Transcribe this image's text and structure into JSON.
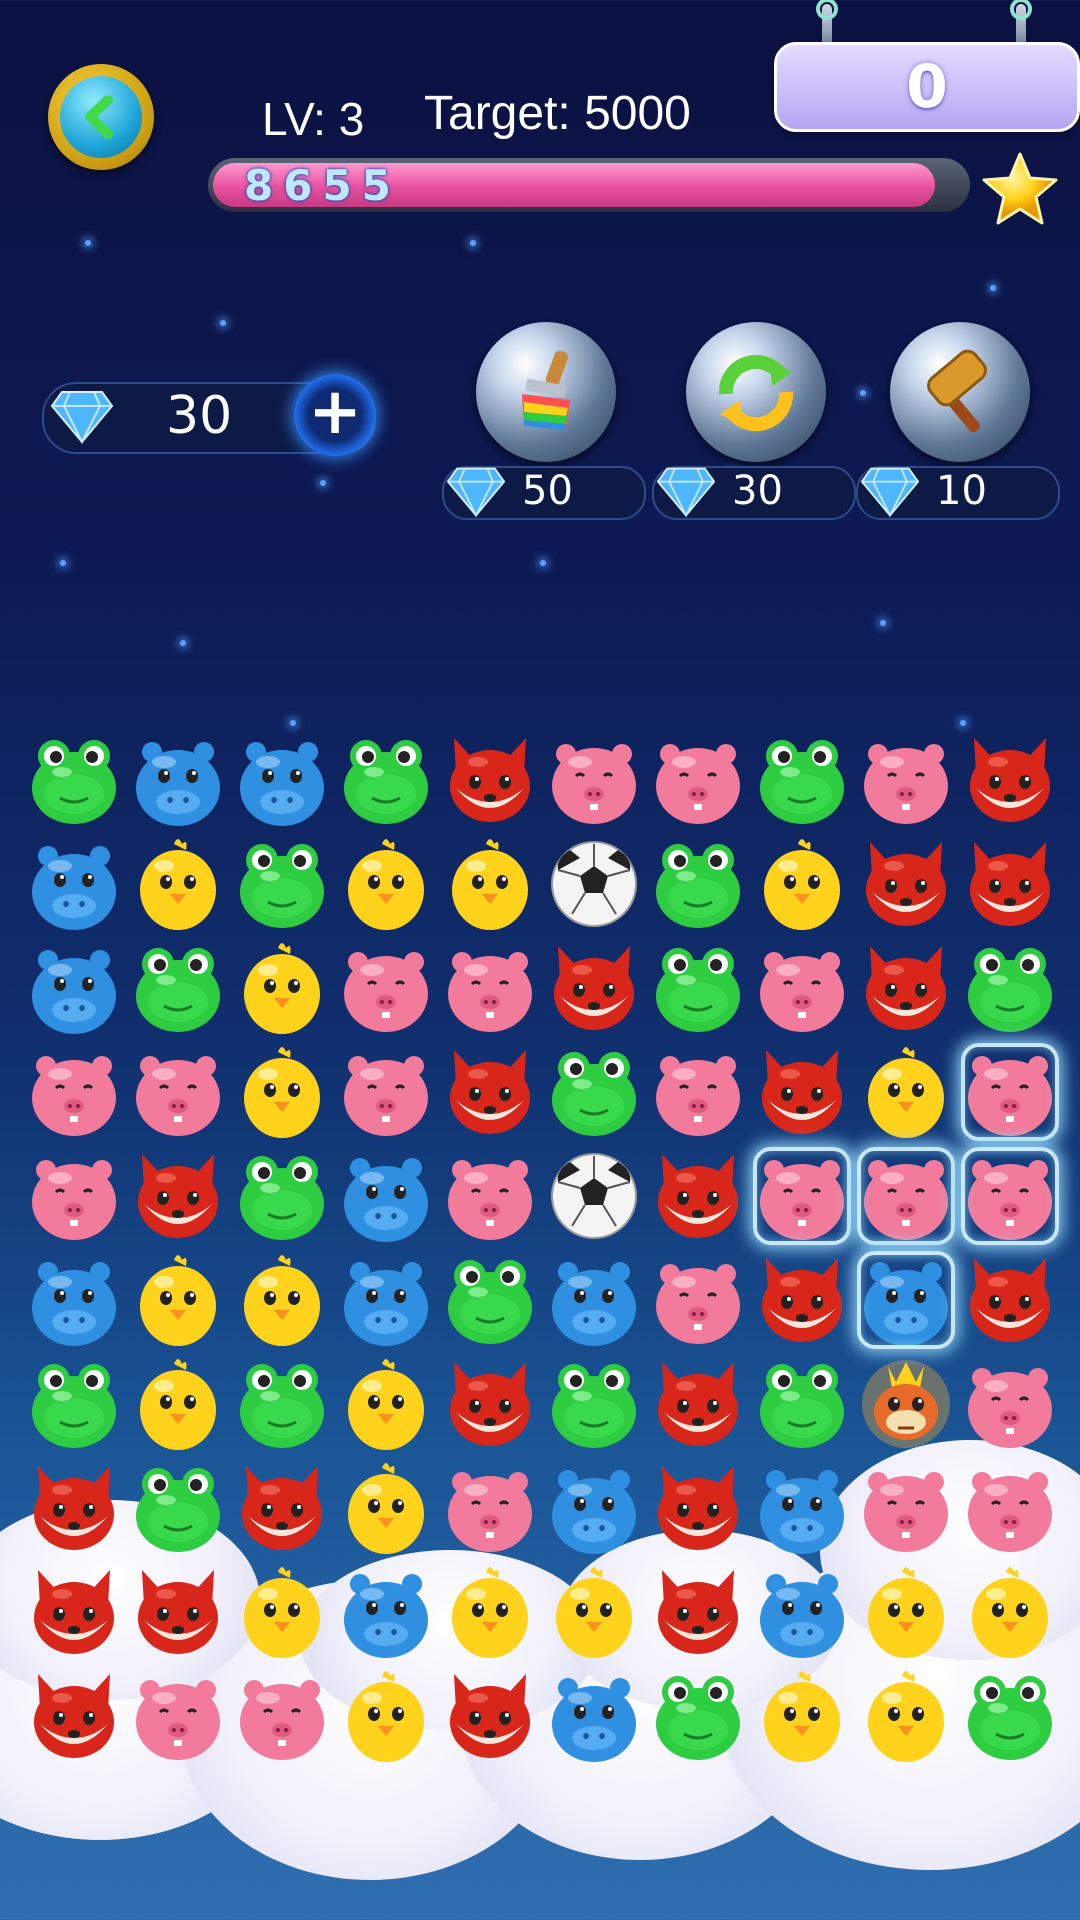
{
  "hud": {
    "level_label": "LV: 3",
    "target_label": "Target: 5000",
    "score": "0",
    "progress_value": "8655",
    "progress_fraction": 0.96
  },
  "gems": {
    "count": "30"
  },
  "powerups": [
    {
      "name": "rainbow-brush",
      "price": "50"
    },
    {
      "name": "refresh",
      "price": "30"
    },
    {
      "name": "hammer",
      "price": "10"
    }
  ],
  "colors": {
    "frog": "#2ecc40",
    "hippo": "#2f8fe0",
    "fox": "#d8261b",
    "pig": "#f27a9a",
    "chick": "#ffd21c",
    "progress": "#e9519f",
    "accent": "#1f6ff0"
  },
  "board": {
    "rows": [
      [
        "frog",
        "hippo",
        "hippo",
        "frog",
        "fox",
        "pig",
        "pig",
        "frog",
        "pig",
        "fox"
      ],
      [
        "hippo",
        "chick",
        "frog",
        "chick",
        "chick",
        "ball",
        "frog",
        "chick",
        "fox",
        "fox"
      ],
      [
        "hippo",
        "frog",
        "chick",
        "pig",
        "pig",
        "fox",
        "frog",
        "pig",
        "fox",
        "frog"
      ],
      [
        "pig",
        "pig",
        "chick",
        "pig",
        "fox",
        "frog",
        "pig",
        "fox",
        "chick",
        "pig"
      ],
      [
        "pig",
        "fox",
        "frog",
        "hippo",
        "pig",
        "ball",
        "fox",
        "pig",
        "pig",
        "pig"
      ],
      [
        "hippo",
        "chick",
        "chick",
        "hippo",
        "frog",
        "hippo",
        "pig",
        "fox",
        "hippo",
        "fox"
      ],
      [
        "frog",
        "chick",
        "frog",
        "chick",
        "fox",
        "frog",
        "fox",
        "frog",
        "dragon",
        "pig"
      ],
      [
        "fox",
        "frog",
        "fox",
        "chick",
        "pig",
        "hippo",
        "fox",
        "hippo",
        "pig",
        "pig"
      ],
      [
        "fox",
        "fox",
        "chick",
        "hippo",
        "chick",
        "chick",
        "fox",
        "hippo",
        "chick",
        "chick"
      ],
      [
        "fox",
        "pig",
        "pig",
        "chick",
        "fox",
        "hippo",
        "frog",
        "chick",
        "chick",
        "frog"
      ]
    ],
    "selected": [
      [
        3,
        9
      ],
      [
        4,
        7
      ],
      [
        4,
        8
      ],
      [
        4,
        9
      ],
      [
        5,
        8
      ]
    ]
  }
}
